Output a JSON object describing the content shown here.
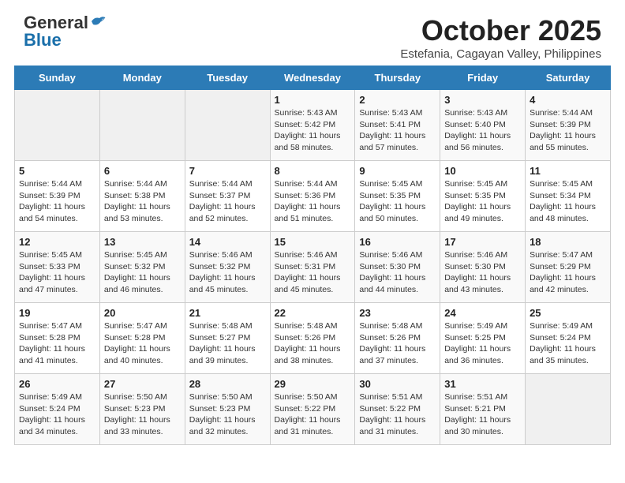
{
  "header": {
    "logo_general": "General",
    "logo_blue": "Blue",
    "month_title": "October 2025",
    "location": "Estefania, Cagayan Valley, Philippines"
  },
  "days_of_week": [
    "Sunday",
    "Monday",
    "Tuesday",
    "Wednesday",
    "Thursday",
    "Friday",
    "Saturday"
  ],
  "weeks": [
    [
      {
        "day": "",
        "info": ""
      },
      {
        "day": "",
        "info": ""
      },
      {
        "day": "",
        "info": ""
      },
      {
        "day": "1",
        "info": "Sunrise: 5:43 AM\nSunset: 5:42 PM\nDaylight: 11 hours\nand 58 minutes."
      },
      {
        "day": "2",
        "info": "Sunrise: 5:43 AM\nSunset: 5:41 PM\nDaylight: 11 hours\nand 57 minutes."
      },
      {
        "day": "3",
        "info": "Sunrise: 5:43 AM\nSunset: 5:40 PM\nDaylight: 11 hours\nand 56 minutes."
      },
      {
        "day": "4",
        "info": "Sunrise: 5:44 AM\nSunset: 5:39 PM\nDaylight: 11 hours\nand 55 minutes."
      }
    ],
    [
      {
        "day": "5",
        "info": "Sunrise: 5:44 AM\nSunset: 5:39 PM\nDaylight: 11 hours\nand 54 minutes."
      },
      {
        "day": "6",
        "info": "Sunrise: 5:44 AM\nSunset: 5:38 PM\nDaylight: 11 hours\nand 53 minutes."
      },
      {
        "day": "7",
        "info": "Sunrise: 5:44 AM\nSunset: 5:37 PM\nDaylight: 11 hours\nand 52 minutes."
      },
      {
        "day": "8",
        "info": "Sunrise: 5:44 AM\nSunset: 5:36 PM\nDaylight: 11 hours\nand 51 minutes."
      },
      {
        "day": "9",
        "info": "Sunrise: 5:45 AM\nSunset: 5:35 PM\nDaylight: 11 hours\nand 50 minutes."
      },
      {
        "day": "10",
        "info": "Sunrise: 5:45 AM\nSunset: 5:35 PM\nDaylight: 11 hours\nand 49 minutes."
      },
      {
        "day": "11",
        "info": "Sunrise: 5:45 AM\nSunset: 5:34 PM\nDaylight: 11 hours\nand 48 minutes."
      }
    ],
    [
      {
        "day": "12",
        "info": "Sunrise: 5:45 AM\nSunset: 5:33 PM\nDaylight: 11 hours\nand 47 minutes."
      },
      {
        "day": "13",
        "info": "Sunrise: 5:45 AM\nSunset: 5:32 PM\nDaylight: 11 hours\nand 46 minutes."
      },
      {
        "day": "14",
        "info": "Sunrise: 5:46 AM\nSunset: 5:32 PM\nDaylight: 11 hours\nand 45 minutes."
      },
      {
        "day": "15",
        "info": "Sunrise: 5:46 AM\nSunset: 5:31 PM\nDaylight: 11 hours\nand 45 minutes."
      },
      {
        "day": "16",
        "info": "Sunrise: 5:46 AM\nSunset: 5:30 PM\nDaylight: 11 hours\nand 44 minutes."
      },
      {
        "day": "17",
        "info": "Sunrise: 5:46 AM\nSunset: 5:30 PM\nDaylight: 11 hours\nand 43 minutes."
      },
      {
        "day": "18",
        "info": "Sunrise: 5:47 AM\nSunset: 5:29 PM\nDaylight: 11 hours\nand 42 minutes."
      }
    ],
    [
      {
        "day": "19",
        "info": "Sunrise: 5:47 AM\nSunset: 5:28 PM\nDaylight: 11 hours\nand 41 minutes."
      },
      {
        "day": "20",
        "info": "Sunrise: 5:47 AM\nSunset: 5:28 PM\nDaylight: 11 hours\nand 40 minutes."
      },
      {
        "day": "21",
        "info": "Sunrise: 5:48 AM\nSunset: 5:27 PM\nDaylight: 11 hours\nand 39 minutes."
      },
      {
        "day": "22",
        "info": "Sunrise: 5:48 AM\nSunset: 5:26 PM\nDaylight: 11 hours\nand 38 minutes."
      },
      {
        "day": "23",
        "info": "Sunrise: 5:48 AM\nSunset: 5:26 PM\nDaylight: 11 hours\nand 37 minutes."
      },
      {
        "day": "24",
        "info": "Sunrise: 5:49 AM\nSunset: 5:25 PM\nDaylight: 11 hours\nand 36 minutes."
      },
      {
        "day": "25",
        "info": "Sunrise: 5:49 AM\nSunset: 5:24 PM\nDaylight: 11 hours\nand 35 minutes."
      }
    ],
    [
      {
        "day": "26",
        "info": "Sunrise: 5:49 AM\nSunset: 5:24 PM\nDaylight: 11 hours\nand 34 minutes."
      },
      {
        "day": "27",
        "info": "Sunrise: 5:50 AM\nSunset: 5:23 PM\nDaylight: 11 hours\nand 33 minutes."
      },
      {
        "day": "28",
        "info": "Sunrise: 5:50 AM\nSunset: 5:23 PM\nDaylight: 11 hours\nand 32 minutes."
      },
      {
        "day": "29",
        "info": "Sunrise: 5:50 AM\nSunset: 5:22 PM\nDaylight: 11 hours\nand 31 minutes."
      },
      {
        "day": "30",
        "info": "Sunrise: 5:51 AM\nSunset: 5:22 PM\nDaylight: 11 hours\nand 31 minutes."
      },
      {
        "day": "31",
        "info": "Sunrise: 5:51 AM\nSunset: 5:21 PM\nDaylight: 11 hours\nand 30 minutes."
      },
      {
        "day": "",
        "info": ""
      }
    ]
  ]
}
